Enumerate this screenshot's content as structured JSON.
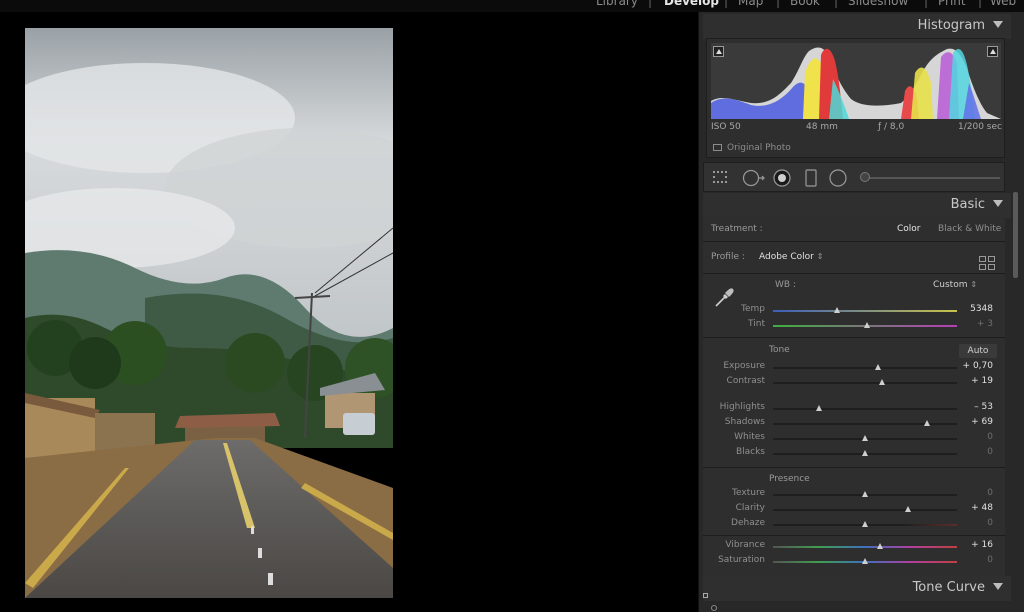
{
  "modules": {
    "items": [
      "Library",
      "Develop",
      "Map",
      "Book",
      "Slideshow",
      "Print",
      "Web"
    ],
    "active": "Develop"
  },
  "histogram": {
    "title": "Histogram",
    "iso": "ISO 50",
    "focal": "48 mm",
    "aperture": "ƒ / 8,0",
    "shutter": "1/200 sec",
    "original_photo": "Original Photo"
  },
  "basic": {
    "title": "Basic",
    "treatment_label": "Treatment :",
    "treatment_color": "Color",
    "treatment_bw": "Black & White",
    "profile_label": "Profile :",
    "profile_value": "Adobe Color",
    "wb_label": "WB :",
    "wb_value": "Custom",
    "tone_label": "Tone",
    "auto_label": "Auto",
    "presence_label": "Presence",
    "sliders": {
      "temp": {
        "label": "Temp",
        "value": "5348",
        "pos": 0.35
      },
      "tint": {
        "label": "Tint",
        "value": "+ 3",
        "pos": 0.51
      },
      "exposure": {
        "label": "Exposure",
        "value": "+ 0,70",
        "pos": 0.57
      },
      "contrast": {
        "label": "Contrast",
        "value": "+ 19",
        "pos": 0.595
      },
      "highlights": {
        "label": "Highlights",
        "value": "– 53",
        "pos": 0.25
      },
      "shadows": {
        "label": "Shadows",
        "value": "+ 69",
        "pos": 0.835
      },
      "whites": {
        "label": "Whites",
        "value": "0",
        "pos": 0.5
      },
      "blacks": {
        "label": "Blacks",
        "value": "0",
        "pos": 0.5
      },
      "texture": {
        "label": "Texture",
        "value": "0",
        "pos": 0.5
      },
      "clarity": {
        "label": "Clarity",
        "value": "+ 48",
        "pos": 0.735
      },
      "dehaze": {
        "label": "Dehaze",
        "value": "0",
        "pos": 0.5
      },
      "vibrance": {
        "label": "Vibrance",
        "value": "+ 16",
        "pos": 0.58
      },
      "saturation": {
        "label": "Saturation",
        "value": "0",
        "pos": 0.5
      }
    }
  },
  "tone_curve": {
    "title": "Tone Curve"
  },
  "colors": {
    "panel_bg": "#2e2e2e",
    "text_highlight": "#e0e0e0",
    "temp_gradient": [
      "#3a5fb8",
      "#c9c24a"
    ],
    "tint_gradient": [
      "#3fae3f",
      "#b53fb5"
    ]
  }
}
